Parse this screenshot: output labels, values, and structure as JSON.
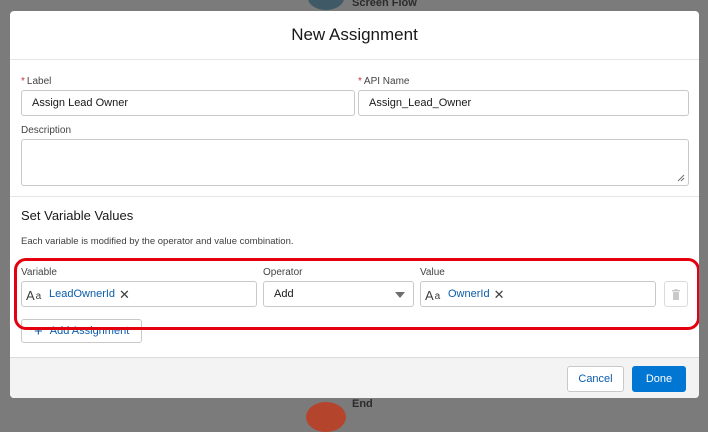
{
  "background": {
    "top_node_label": "Screen Flow",
    "bottom_node_label": "End"
  },
  "modal": {
    "title": "New Assignment"
  },
  "fields": {
    "label": {
      "label": "Label",
      "required_mark": "*",
      "value": "Assign Lead Owner"
    },
    "api_name": {
      "label": "API Name",
      "required_mark": "*",
      "value": "Assign_Lead_Owner"
    },
    "description": {
      "label": "Description",
      "value": ""
    }
  },
  "set_variables": {
    "title": "Set Variable Values",
    "description": "Each variable is modified by the operator and value combination.",
    "columns": {
      "variable": "Variable",
      "operator": "Operator",
      "value": "Value"
    },
    "row": {
      "variable": "LeadOwnerId",
      "operator": "Add",
      "value": "OwnerId",
      "icon_main": "A",
      "icon_sub": "a",
      "remove_glyph": "✕"
    },
    "add_label": "Add Assignment",
    "add_glyph": "+"
  },
  "footer": {
    "cancel_label": "Cancel",
    "done_label": "Done"
  },
  "colors": {
    "brand": "#0176d3",
    "link": "#0b5cab",
    "highlight": "#e5000f",
    "required": "#c23934"
  },
  "icons": [
    "text-type-icon",
    "close-icon",
    "chevron-down-icon",
    "trash-icon",
    "plus-icon",
    "resize-grip-icon"
  ]
}
